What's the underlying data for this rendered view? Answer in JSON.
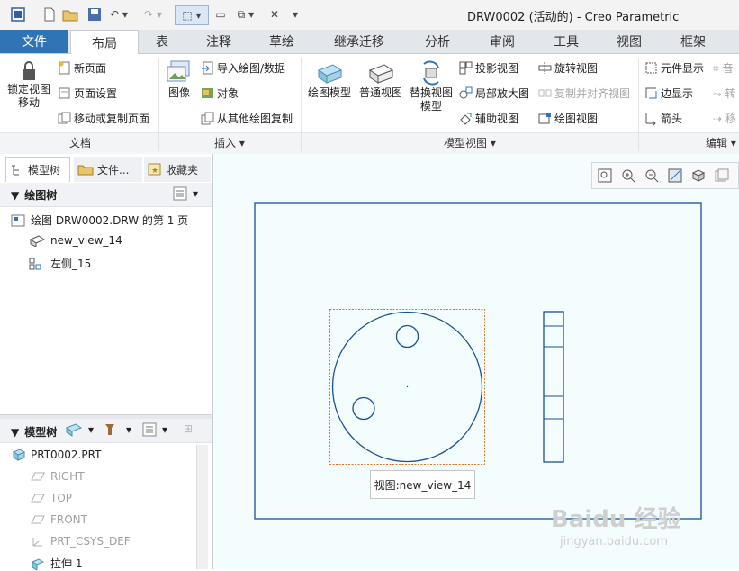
{
  "window": {
    "title": "DRW0002 (活动的) - Creo Parametric"
  },
  "tabs": [
    {
      "label": "文件"
    },
    {
      "label": "布局"
    },
    {
      "label": "表"
    },
    {
      "label": "注释"
    },
    {
      "label": "草绘"
    },
    {
      "label": "继承迁移"
    },
    {
      "label": "分析"
    },
    {
      "label": "审阅"
    },
    {
      "label": "工具"
    },
    {
      "label": "视图"
    },
    {
      "label": "框架"
    }
  ],
  "active_tab": "布局",
  "ribbon": {
    "doc_group": {
      "label": "文档",
      "lock_view": "锁定视图\n移动",
      "new_page": "新页面",
      "page_setup": "页面设置",
      "move_copy_page": "移动或复制页面"
    },
    "insert_group": {
      "label": "插入",
      "image": "图像",
      "import_drawing": "导入绘图/数据",
      "object": "对象",
      "copy_from_drawing": "从其他绘图复制"
    },
    "model_view_group": {
      "label": "模型视图",
      "drawing_model": "绘图模型",
      "general_view": "普通视图",
      "replace_view_model": "替换视图\n模型",
      "projection_view": "投影视图",
      "detail_view": "局部放大图",
      "auxiliary_view": "辅助视图",
      "revolved_view": "旋转视图",
      "copy_align_view": "复制并对齐视图",
      "drawing_view": "绘图视图"
    },
    "edit_group": {
      "label": "编辑",
      "component_display": "元件显示",
      "edge_display": "边显示",
      "arrow": "箭头"
    }
  },
  "left_pane": {
    "tabs": [
      {
        "label": "模型树"
      },
      {
        "label": "文件..."
      },
      {
        "label": "收藏夹"
      }
    ],
    "drawing_tree": {
      "header": "绘图树",
      "items": [
        {
          "label": "绘图 DRW0002.DRW 的第 1 页"
        },
        {
          "label": "new_view_14"
        },
        {
          "label": "左侧_15"
        }
      ]
    },
    "model_tree": {
      "header": "模型树",
      "items": [
        {
          "label": "PRT0002.PRT",
          "dim": false
        },
        {
          "label": "RIGHT",
          "dim": true
        },
        {
          "label": "TOP",
          "dim": true
        },
        {
          "label": "FRONT",
          "dim": true
        },
        {
          "label": "PRT_CSYS_DEF",
          "dim": true
        },
        {
          "label": "拉伸 1",
          "dim": false
        }
      ]
    }
  },
  "canvas": {
    "view_label": "视图:new_view_14",
    "watermark": "Baidu 经验",
    "watermark_url": "jingyan.baidu.com"
  },
  "colors": {
    "accent": "#2f75b5",
    "drawing_line": "#1a4f93",
    "selection": "#e0702a",
    "canvas_bg": "#f3fdfd"
  }
}
